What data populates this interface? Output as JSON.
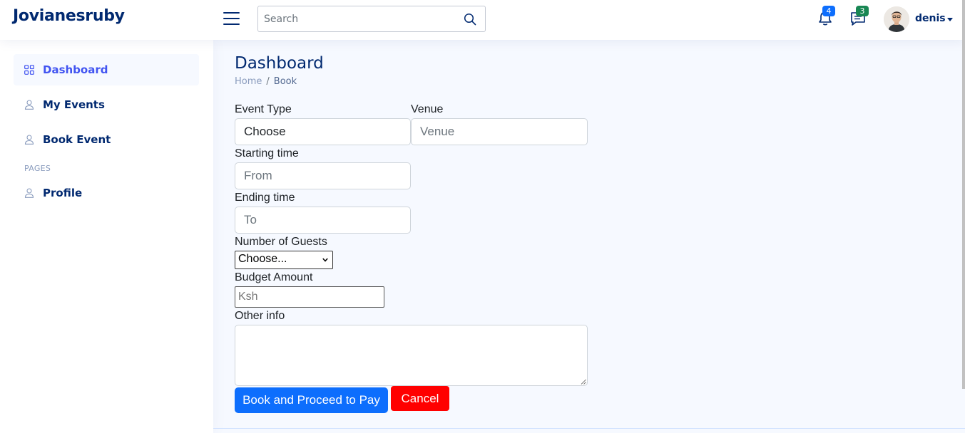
{
  "header": {
    "logo": "Jovianesruby",
    "search": {
      "placeholder": "Search"
    },
    "notifications": {
      "count": "4",
      "color": "#0d6efd"
    },
    "messages": {
      "count": "3",
      "color": "#198754"
    },
    "user": {
      "name": "denis"
    }
  },
  "sidebar": {
    "items": [
      {
        "label": "Dashboard",
        "icon": "grid-icon",
        "active": true
      },
      {
        "label": "My Events",
        "icon": "person-icon"
      },
      {
        "label": "Book Event",
        "icon": "person-icon"
      }
    ],
    "section_heading": "PAGES",
    "pages": [
      {
        "label": "Profile",
        "icon": "person-icon"
      }
    ]
  },
  "main": {
    "title": "Dashboard",
    "breadcrumb": {
      "home": "Home",
      "separator": "/",
      "current": "Book"
    },
    "form": {
      "event_type": {
        "label": "Event Type",
        "value": "Choose"
      },
      "venue": {
        "label": "Venue",
        "placeholder": "Venue"
      },
      "start": {
        "label": "Starting time",
        "placeholder": "From"
      },
      "end": {
        "label": "Ending time",
        "placeholder": "To"
      },
      "guests": {
        "label": "Number of Guests",
        "value": "Choose..."
      },
      "budget": {
        "label": "Budget Amount",
        "placeholder": "Ksh"
      },
      "other": {
        "label": "Other info"
      },
      "submit_label": "Book and Proceed to Pay",
      "cancel_label": "Cancel"
    }
  },
  "colors": {
    "accent": "#4154f1",
    "navy": "#012970",
    "primary": "#0d6efd",
    "danger": "#ff0000"
  }
}
